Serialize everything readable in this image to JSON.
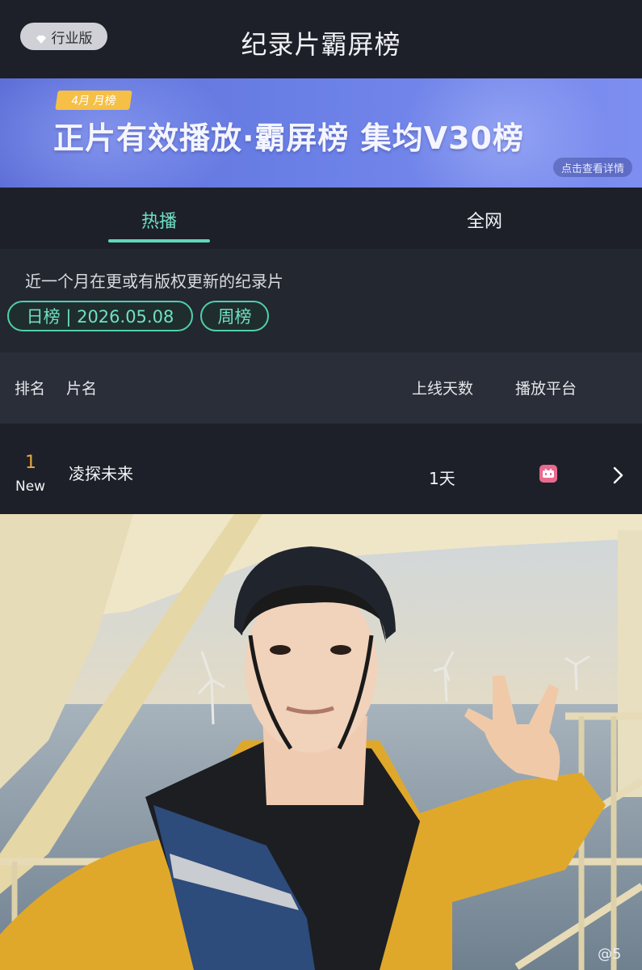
{
  "header": {
    "badge_label": "行业版",
    "title": "纪录片霸屏榜"
  },
  "banner": {
    "month_tag": "4月 月榜",
    "title": "正片有效播放·霸屏榜 集均V30榜",
    "detail_link": "点击查看详情"
  },
  "tabs": [
    {
      "label": "热播",
      "active": true
    },
    {
      "label": "全网",
      "active": false
    }
  ],
  "filter": {
    "description": "近一个月在更或有版权更新的纪录片",
    "daily_pill": "日榜 | 2026.05.08",
    "weekly_pill": "周榜"
  },
  "table": {
    "headers": {
      "rank": "排名",
      "name": "片名",
      "days": "上线天数",
      "platform": "播放平台"
    },
    "rows": [
      {
        "rank": "1",
        "badge": "New",
        "title": "凌探未来",
        "days": "1天",
        "platform_icon": "bilibili-icon"
      }
    ]
  },
  "colors": {
    "accent": "#5fd8bb",
    "rank": "#e8a93c",
    "banner": "#6a7fe6",
    "month_tag": "#f6bf46"
  },
  "photo": {
    "watermark": "@5"
  }
}
